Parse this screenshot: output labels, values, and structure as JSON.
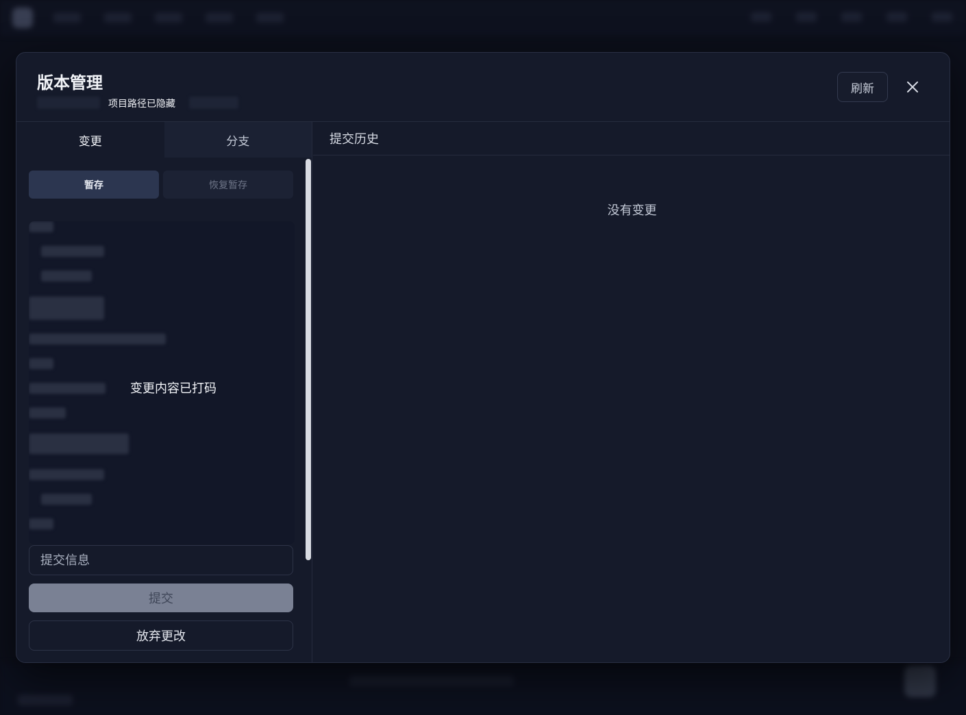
{
  "modal": {
    "title": "版本管理",
    "path_text": "项目路径已隐藏",
    "refresh_label": "刷新",
    "close_icon": "close-icon"
  },
  "left": {
    "tabs": [
      {
        "label": "变更",
        "active": true
      },
      {
        "label": "分支",
        "active": false
      }
    ],
    "stash_label": "暂存",
    "restore_stash_label": "恢复暂存",
    "changes_masked_text": "变更内容已打码",
    "commit_placeholder": "提交信息",
    "commit_label": "提交",
    "discard_label": "放弃更改"
  },
  "right": {
    "history_title": "提交历史",
    "empty_text": "没有变更"
  },
  "colors": {
    "background": "#0c0f1a",
    "modal_bg": "#151a2a",
    "accent_button": "#2c3650",
    "commit_button": "#7a8194"
  }
}
